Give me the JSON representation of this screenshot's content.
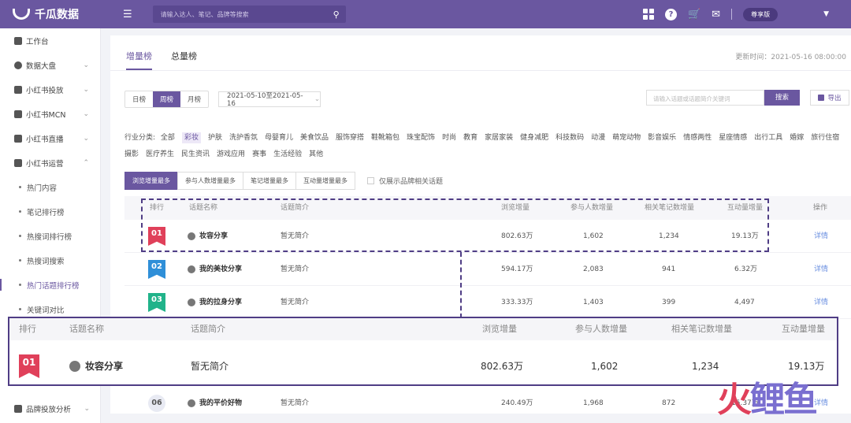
{
  "app": {
    "name": "千瓜数据",
    "search_placeholder": "请输入达人、笔记、品牌等搜索",
    "badge": "尊享版"
  },
  "sidebar": {
    "items": [
      {
        "label": "工作台"
      },
      {
        "label": "数据大盘"
      },
      {
        "label": "小红书投放"
      },
      {
        "label": "小红书MCN"
      },
      {
        "label": "小红书直播"
      },
      {
        "label": "小红书运营"
      }
    ],
    "subitems": [
      {
        "label": "热门内容"
      },
      {
        "label": "笔记排行榜"
      },
      {
        "label": "热搜词排行榜"
      },
      {
        "label": "热搜词搜索"
      },
      {
        "label": "热门话题排行榜"
      },
      {
        "label": "关键词对比"
      }
    ],
    "bottom_item": {
      "label": "品牌投放分析"
    }
  },
  "tabs": [
    "增量榜",
    "总量榜"
  ],
  "updated": "更新时间：2021-05-16 08:00:00",
  "period": [
    "日榜",
    "周榜",
    "月榜"
  ],
  "date_range": "2021-05-10至2021-05-16",
  "search2_placeholder": "请输入话题或话题简介关键词",
  "search_btn": "搜索",
  "export_btn": "导出",
  "category_label": "行业分类:",
  "categories": [
    "全部",
    "彩妆",
    "护肤",
    "洗护香氛",
    "母婴育儿",
    "美食饮品",
    "服饰穿搭",
    "鞋靴箱包",
    "珠宝配饰",
    "时尚",
    "教育",
    "家居家装",
    "健身减肥",
    "科技数码",
    "动漫",
    "萌宠动物",
    "影音娱乐",
    "情感两性",
    "星座情感",
    "出行工具",
    "婚嫁",
    "旅行住宿",
    "摄影",
    "医疗养生",
    "民生资讯",
    "游戏应用",
    "赛事",
    "生活经验",
    "其他"
  ],
  "sort_tabs": [
    "浏览增量最多",
    "参与人数增量最多",
    "笔记增量最多",
    "互动量增量最多"
  ],
  "checkbox_label": "仅展示品牌相关话题",
  "table": {
    "headers": {
      "rank": "排行",
      "name": "话题名称",
      "intro": "话题简介",
      "views": "浏览增量",
      "participants": "参与人数增量",
      "notes": "相关笔记数增量",
      "interactions": "互动量增量",
      "ops": "操作"
    },
    "rows": [
      {
        "rank": "01",
        "name": "妆容分享",
        "intro": "暂无简介",
        "views": "802.63万",
        "participants": "1,602",
        "notes": "1,234",
        "interactions": "19.13万",
        "op": "详情"
      },
      {
        "rank": "02",
        "name": "我的美妆分享",
        "intro": "暂无简介",
        "views": "594.17万",
        "participants": "2,083",
        "notes": "941",
        "interactions": "6.32万",
        "op": "详情"
      },
      {
        "rank": "03",
        "name": "我的拉身分享",
        "intro": "暂无简介",
        "views": "333.33万",
        "participants": "1,403",
        "notes": "399",
        "interactions": "4,497",
        "op": "详情"
      },
      {
        "rank": "06",
        "name": "我的平价好物",
        "intro": "暂无简介",
        "views": "240.49万",
        "participants": "1,968",
        "notes": "872",
        "interactions": "15.37万",
        "op": "详情"
      }
    ]
  },
  "colors": {
    "brand": "#6a57a0",
    "rank1": "#e0405a",
    "rank2": "#2f8fd8",
    "rank3": "#21b38a"
  },
  "watermark": {
    "a": "火",
    "b": "鲤鱼"
  }
}
